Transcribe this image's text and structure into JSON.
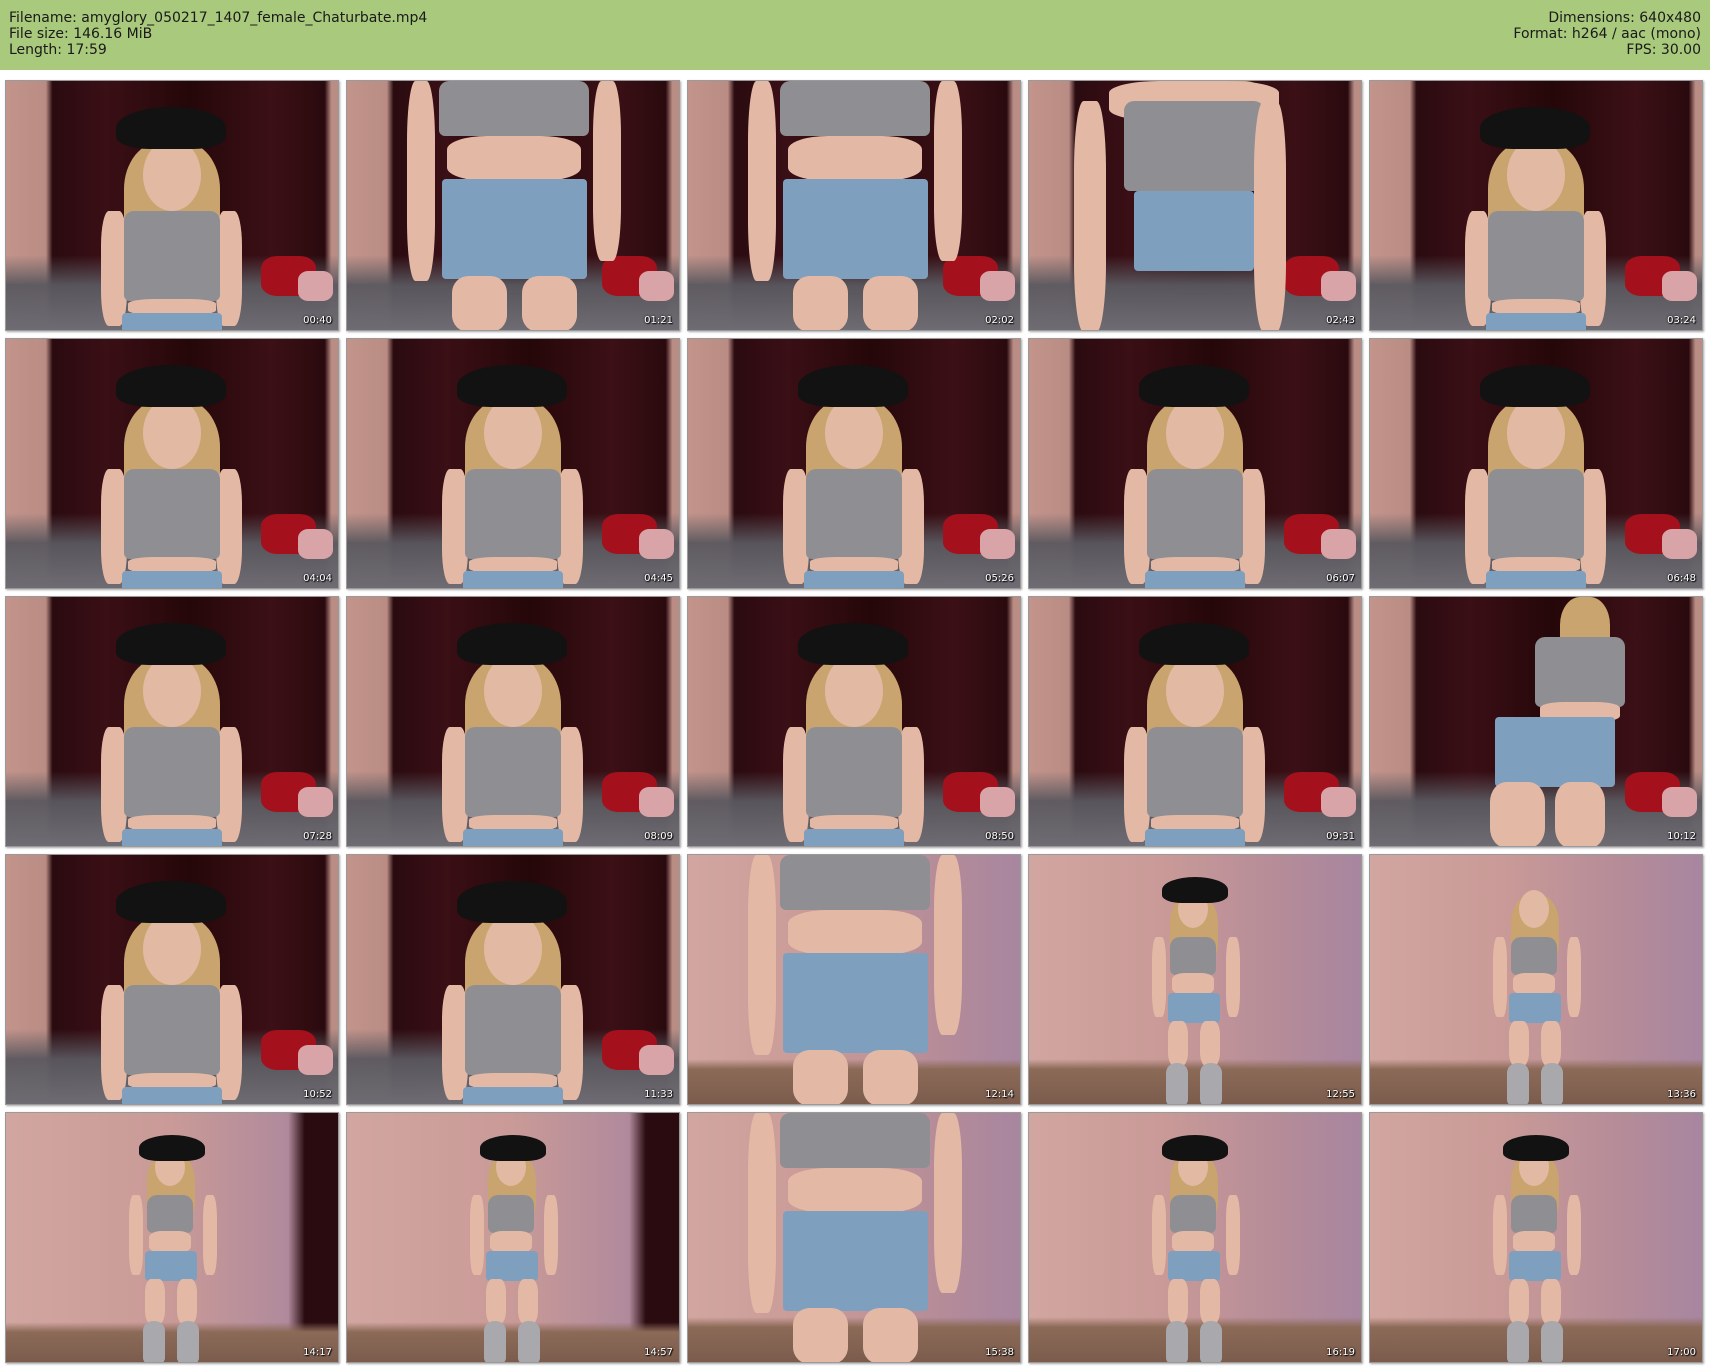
{
  "header": {
    "filename_line": "Filename: amyglory_050217_1407_female_Chaturbate.mp4",
    "filesize_line": "File size: 146.16 MiB",
    "length_line": "Length: 17:59",
    "dimensions_line": "Dimensions: 640x480",
    "format_line": "Format: h264 / aac (mono)",
    "fps_line": "FPS: 30.00",
    "background_color": "#a9c97c"
  },
  "thumbnails": [
    {
      "time": "00:40",
      "scene": "room",
      "pose": "seated-hat"
    },
    {
      "time": "01:21",
      "scene": "room",
      "pose": "torso-closeup"
    },
    {
      "time": "02:02",
      "scene": "room",
      "pose": "torso-closeup"
    },
    {
      "time": "02:43",
      "scene": "room",
      "pose": "leaning-torso"
    },
    {
      "time": "03:24",
      "scene": "room",
      "pose": "seated-hat"
    },
    {
      "time": "04:04",
      "scene": "room",
      "pose": "seated-hat"
    },
    {
      "time": "04:45",
      "scene": "room",
      "pose": "seated-hat"
    },
    {
      "time": "05:26",
      "scene": "room",
      "pose": "seated-hat"
    },
    {
      "time": "06:07",
      "scene": "room",
      "pose": "seated-hat"
    },
    {
      "time": "06:48",
      "scene": "room",
      "pose": "seated-hat"
    },
    {
      "time": "07:28",
      "scene": "room",
      "pose": "seated-hat"
    },
    {
      "time": "08:09",
      "scene": "room",
      "pose": "seated-hat"
    },
    {
      "time": "08:50",
      "scene": "room",
      "pose": "seated-hat"
    },
    {
      "time": "09:31",
      "scene": "room",
      "pose": "seated-hat"
    },
    {
      "time": "10:12",
      "scene": "room",
      "pose": "back-view"
    },
    {
      "time": "10:52",
      "scene": "room",
      "pose": "seated-hat"
    },
    {
      "time": "11:33",
      "scene": "room",
      "pose": "seated-hat"
    },
    {
      "time": "12:14",
      "scene": "wall",
      "pose": "torso-closeup"
    },
    {
      "time": "12:55",
      "scene": "wall",
      "pose": "standing-hat"
    },
    {
      "time": "13:36",
      "scene": "wall",
      "pose": "standing-nohat"
    },
    {
      "time": "14:17",
      "scene": "wall-dark",
      "pose": "standing-hat"
    },
    {
      "time": "14:57",
      "scene": "wall-dark",
      "pose": "standing-hat"
    },
    {
      "time": "15:38",
      "scene": "wall",
      "pose": "torso-closeup"
    },
    {
      "time": "16:19",
      "scene": "wall",
      "pose": "standing-hat"
    },
    {
      "time": "17:00",
      "scene": "wall",
      "pose": "standing-hat"
    }
  ]
}
